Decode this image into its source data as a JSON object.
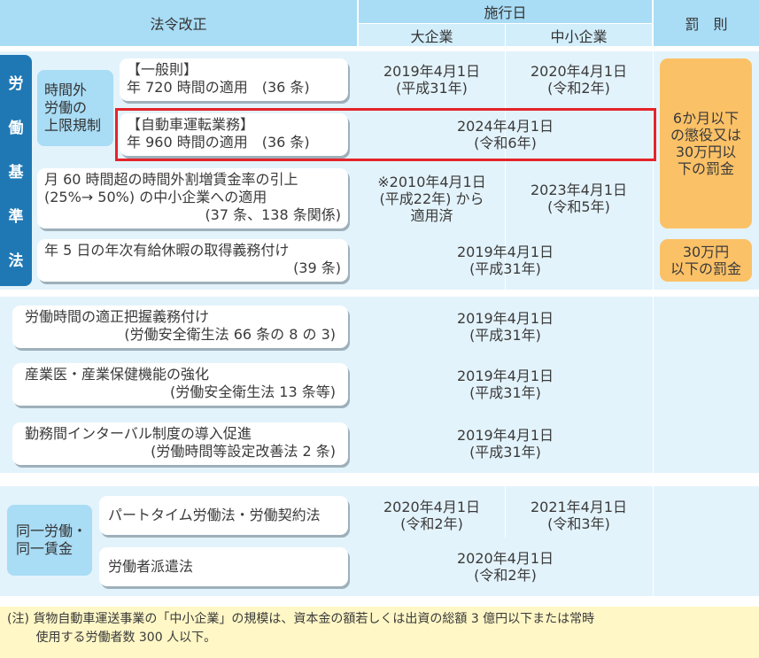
{
  "header": {
    "law": "法令改正",
    "effective_date": "施行日",
    "large_company": "大企業",
    "sme": "中小企業",
    "penalty": "罰　則"
  },
  "labor_standards": {
    "side_label": [
      "労",
      "働",
      "基",
      "準",
      "法"
    ],
    "overtime_label": [
      "時間外",
      "労働の",
      "上限規制"
    ],
    "general": {
      "title": "【一般則】",
      "detail": "年 720 時間の適用　(36 条)",
      "large": [
        "2019年4月1日",
        "(平成31年)"
      ],
      "sme": [
        "2020年4月1日",
        "(令和2年)"
      ]
    },
    "driving": {
      "title": "【自動車運転業務】",
      "detail": "年 960 時間の適用　(36 条)",
      "date": [
        "2024年4月1日",
        "(令和6年)"
      ]
    },
    "overtime_rate": {
      "lines": [
        "月 60 時間超の時間外割増賃金率の引上",
        "(25%→ 50%) の中小企業への適用",
        "(37 条、138 条関係)"
      ],
      "large": [
        "※2010年4月1日",
        "(平成22年) から",
        "適用済"
      ],
      "sme": [
        "2023年4月1日",
        "(令和5年)"
      ]
    },
    "paid_leave": {
      "lines": [
        "年 5 日の年次有給休暇の取得義務付け",
        "(39 条)"
      ],
      "date": [
        "2019年4月1日",
        "(平成31年)"
      ]
    },
    "penalty1": [
      "6か月以下",
      "の懲役又は",
      "30万円以",
      "下の罰金"
    ],
    "penalty2": [
      "30万円",
      "以下の罰金"
    ]
  },
  "safety": [
    {
      "lines": [
        "労働時間の適正把握義務付け",
        "(労働安全衛生法 66 条の 8 の 3)"
      ],
      "date": [
        "2019年4月1日",
        "(平成31年)"
      ]
    },
    {
      "lines": [
        "産業医・産業保健機能の強化",
        "(労働安全衛生法 13 条等)"
      ],
      "date": [
        "2019年4月1日",
        "(平成31年)"
      ]
    },
    {
      "lines": [
        "勤務間インターバル制度の導入促進",
        "(労働時間等設定改善法 2 条)"
      ],
      "date": [
        "2019年4月1日",
        "(平成31年)"
      ]
    }
  ],
  "equal_pay": {
    "label": [
      "同一労働・",
      "同一賃金"
    ],
    "parttime": {
      "title": "パートタイム労働法・労働契約法",
      "large": [
        "2020年4月1日",
        "(令和2年)"
      ],
      "sme": [
        "2021年4月1日",
        "(令和3年)"
      ]
    },
    "dispatch": {
      "title": "労働者派遣法",
      "date": [
        "2020年4月1日",
        "(令和2年)"
      ]
    }
  },
  "note": {
    "lines": [
      "(注) 貨物自動車運送事業の「中小企業」の規模は、資本金の額若しくは出資の総額 3 億円以下または常時",
      "　　 使用する労働者数 300 人以下。"
    ]
  },
  "colors": {
    "header": "#a9dcf5",
    "panel": "#e3f3fb",
    "side": "#1f78b4",
    "penalty": "#fbc167",
    "highlight": "#e5242b",
    "note": "#fff7c6"
  }
}
